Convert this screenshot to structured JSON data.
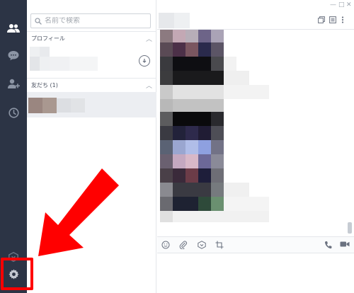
{
  "rail": {
    "items": [
      {
        "name": "friends",
        "icon": "people-icon",
        "active": true
      },
      {
        "name": "chats",
        "icon": "chat-bubble-icon",
        "active": false
      },
      {
        "name": "add-friend",
        "icon": "add-person-icon",
        "active": false
      },
      {
        "name": "timeline",
        "icon": "clock-icon",
        "active": false
      }
    ],
    "bottom": [
      {
        "name": "keep",
        "icon": "download-circle-icon"
      },
      {
        "name": "settings",
        "icon": "gear-icon"
      }
    ]
  },
  "friends_panel": {
    "search_placeholder": "名前で検索",
    "profile_section_label": "プロフィール",
    "friends_section_label": "友だち (1)"
  },
  "colors": {
    "rail_bg": "#2c3445",
    "highlight": "#ff0000",
    "accent_icon": "#c3c8d1"
  }
}
